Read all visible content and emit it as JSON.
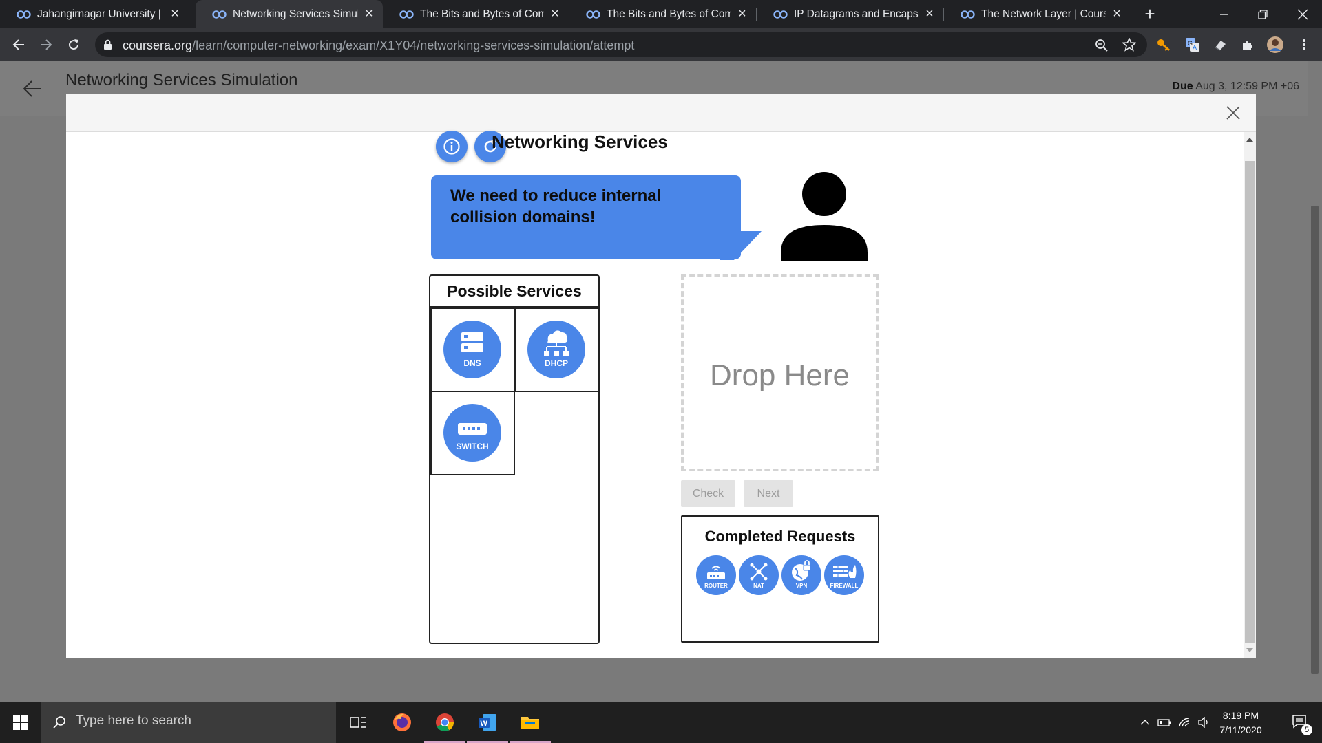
{
  "browser": {
    "tabs": [
      {
        "title": "Jahangirnagar University | Co",
        "active": false
      },
      {
        "title": "Networking Services Simulati",
        "active": true
      },
      {
        "title": "The Bits and Bytes of Compu",
        "active": false
      },
      {
        "title": "The Bits and Bytes of Compu",
        "active": false
      },
      {
        "title": "IP Datagrams and Encapsulat",
        "active": false
      },
      {
        "title": "The Network Layer | Courser",
        "active": false
      }
    ],
    "new_tab": "+",
    "url_domain": "coursera.org",
    "url_path": "/learn/computer-networking/exam/X1Y04/networking-services-simulation/attempt"
  },
  "page": {
    "title": "Networking Services Simulation",
    "due_label": "Due",
    "due_value": "Aug 3, 12:59 PM +06"
  },
  "sim": {
    "title": "Networking Services",
    "request": "We need to reduce internal collision domains!",
    "services_title": "Possible Services",
    "services": [
      {
        "label": "DNS",
        "icon": "dns-server-icon"
      },
      {
        "label": "DHCP",
        "icon": "dhcp-cloud-icon"
      },
      {
        "label": "SWITCH",
        "icon": "switch-icon"
      }
    ],
    "drop_text": "Drop Here",
    "check_label": "Check",
    "next_label": "Next",
    "completed_title": "Completed Requests",
    "completed": [
      {
        "label": "ROUTER",
        "icon": "router-icon"
      },
      {
        "label": "NAT",
        "icon": "nat-icon"
      },
      {
        "label": "VPN",
        "icon": "vpn-icon"
      },
      {
        "label": "FIREWALL",
        "icon": "firewall-icon"
      }
    ],
    "accent_color": "#4a86e8"
  },
  "taskbar": {
    "search_placeholder": "Type here to search",
    "time": "8:19 PM",
    "date": "7/11/2020",
    "notification_count": "5"
  }
}
